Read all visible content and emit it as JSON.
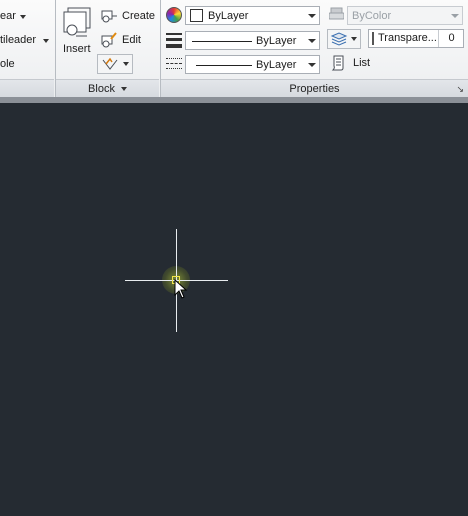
{
  "ribbon": {
    "annotation_panel": {
      "item1_label": "ear",
      "item2_label": "tileader",
      "item3_label": "ole"
    },
    "block_panel": {
      "insert_label": "Insert",
      "create_label": "Create",
      "edit_label": "Edit",
      "panel_title": "Block"
    },
    "properties_panel": {
      "color_value": "ByLayer",
      "linetype_value": "ByLayer",
      "lineweight_value": "ByLayer",
      "plotstyle_value": "ByColor",
      "transparency_label": "Transpare...",
      "transparency_value": "0",
      "list_label": "List",
      "panel_title": "Properties"
    }
  },
  "colors": {
    "canvas_background": "#252b32",
    "crosshair": "#e8ecef",
    "pickbox": "#f3e64a"
  }
}
